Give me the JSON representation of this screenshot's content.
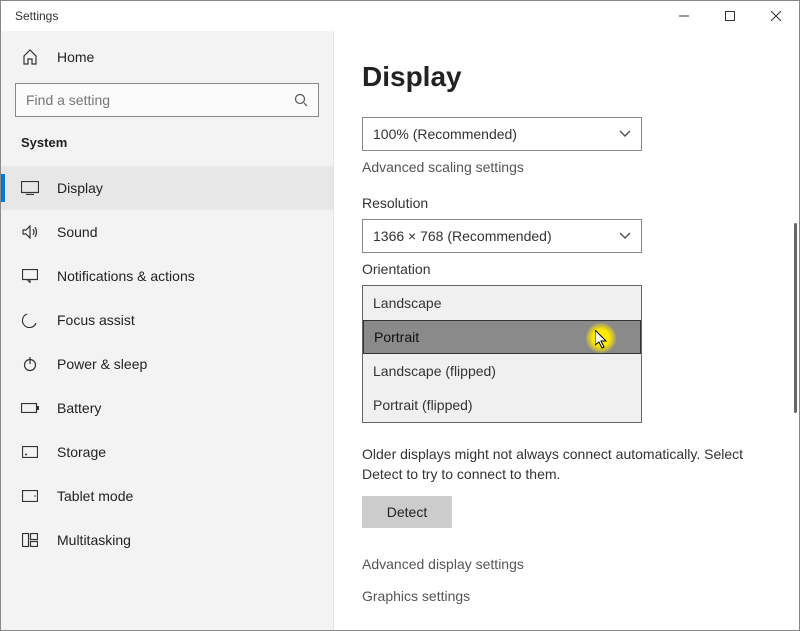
{
  "window": {
    "title": "Settings"
  },
  "sidebar": {
    "home_label": "Home",
    "search_placeholder": "Find a setting",
    "group_title": "System",
    "items": [
      {
        "label": "Display"
      },
      {
        "label": "Sound"
      },
      {
        "label": "Notifications & actions"
      },
      {
        "label": "Focus assist"
      },
      {
        "label": "Power & sleep"
      },
      {
        "label": "Battery"
      },
      {
        "label": "Storage"
      },
      {
        "label": "Tablet mode"
      },
      {
        "label": "Multitasking"
      }
    ]
  },
  "main": {
    "heading": "Display",
    "scale_value": "100% (Recommended)",
    "advanced_scaling_link": "Advanced scaling settings",
    "resolution_label": "Resolution",
    "resolution_value": "1366 × 768 (Recommended)",
    "orientation_label": "Orientation",
    "orientation_options": [
      "Landscape",
      "Portrait",
      "Landscape (flipped)",
      "Portrait (flipped)"
    ],
    "detect_text": "Older displays might not always connect automatically. Select Detect to try to connect to them.",
    "detect_button": "Detect",
    "advanced_display_link": "Advanced display settings",
    "graphics_settings_link": "Graphics settings"
  }
}
